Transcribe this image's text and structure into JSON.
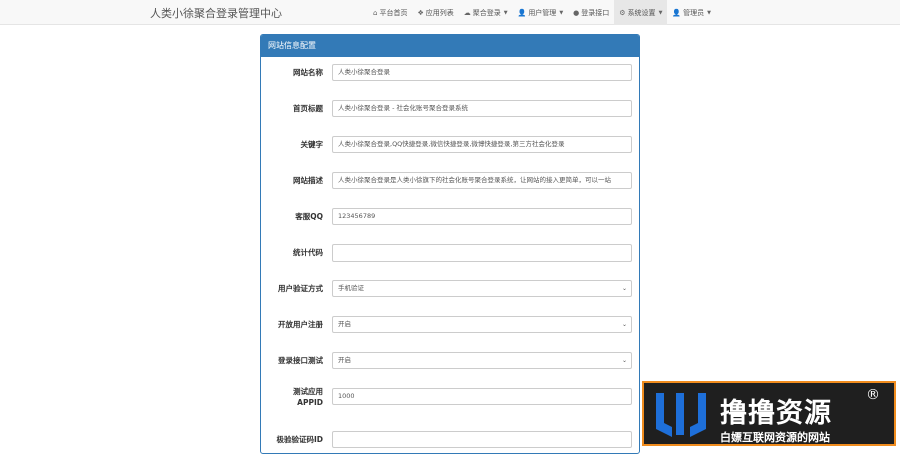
{
  "navbar": {
    "brand": "人类小徐聚合登录管理中心",
    "items": [
      {
        "icon": "home-icon",
        "label": "平台首页",
        "has_dropdown": false
      },
      {
        "icon": "apps-icon",
        "label": "应用列表",
        "has_dropdown": false
      },
      {
        "icon": "cloud-icon",
        "label": "聚合登录",
        "has_dropdown": true
      },
      {
        "icon": "user-icon",
        "label": "用户管理",
        "has_dropdown": true
      },
      {
        "icon": "login-api-icon",
        "label": "登录接口",
        "has_dropdown": false
      },
      {
        "icon": "gear-icon",
        "label": "系统设置",
        "has_dropdown": true,
        "active": true
      },
      {
        "icon": "admin-icon",
        "label": "管理员",
        "has_dropdown": true
      }
    ]
  },
  "panel": {
    "title": "网站信息配置",
    "fields": {
      "site_name": {
        "label": "网站名称",
        "value": "人类小徐聚合登录"
      },
      "home_title": {
        "label": "首页标题",
        "value": "人类小徐聚合登录 - 社会化账号聚合登录系统"
      },
      "keywords": {
        "label": "关键字",
        "value": "人类小徐聚合登录,QQ快捷登录,微信快捷登录,微博快捷登录,第三方社会化登录"
      },
      "description": {
        "label": "网站描述",
        "value": "人类小徐聚合登录是人类小徐旗下的社会化账号聚合登录系统，让网站的接入更简单，可以一站"
      },
      "qq": {
        "label": "客服QQ",
        "value": "123456789"
      },
      "stats_code": {
        "label": "统计代码",
        "value": ""
      },
      "verify_method": {
        "label": "用户验证方式",
        "value": "手机验证"
      },
      "open_register": {
        "label": "开放用户注册",
        "value": "开启"
      },
      "api_test": {
        "label": "登录接口测试",
        "value": "开启"
      },
      "test_appid": {
        "label": "测试应用APPID",
        "label_line1": "测试应用",
        "label_line2": "APPID",
        "value": "1000"
      },
      "captcha_id": {
        "label": "极验验证码ID",
        "value": ""
      }
    }
  },
  "watermark": {
    "title": "撸撸资源",
    "registered": "®",
    "subtitle": "白嫖互联网资源的网站",
    "colors": {
      "border": "#f08c1e",
      "background": "#1f1f1f",
      "logo": "#1e6fd9"
    }
  },
  "colors": {
    "primary": "#337ab7",
    "navbar_bg": "#f8f8f8",
    "active_nav_bg": "#e7e7e7"
  }
}
